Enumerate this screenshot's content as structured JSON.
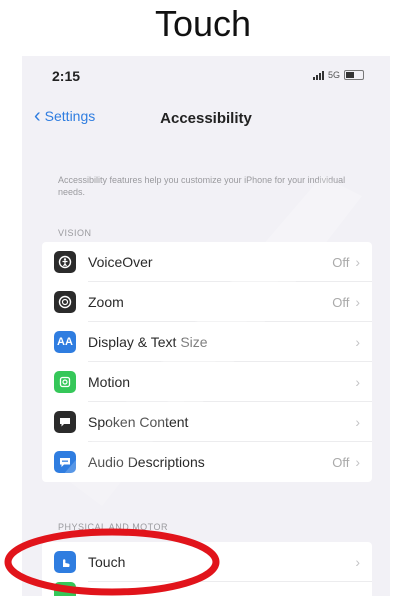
{
  "caption": "Touch",
  "status_bar": {
    "time": "2:15",
    "network": "5G"
  },
  "nav": {
    "back_label": "Settings",
    "title": "Accessibility"
  },
  "intro": "Accessibility features help you customize your iPhone for your individual needs.",
  "sections": {
    "vision_header": "VISION",
    "physical_header": "PHYSICAL AND MOTOR"
  },
  "vision_items": [
    {
      "label": "VoiceOver",
      "value": "Off",
      "icon": "voiceover-icon",
      "color": "#2b2b2b"
    },
    {
      "label": "Zoom",
      "value": "Off",
      "icon": "zoom-icon",
      "color": "#2b2b2b"
    },
    {
      "label": "Display & Text Size",
      "value": "",
      "icon": "display-text-size-icon",
      "icon_text": "AA",
      "color": "#2f7de0"
    },
    {
      "label": "Motion",
      "value": "",
      "icon": "motion-icon",
      "color": "#35c759"
    },
    {
      "label": "Spoken Content",
      "value": "",
      "icon": "spoken-content-icon",
      "color": "#2b2b2b"
    },
    {
      "label": "Audio Descriptions",
      "value": "Off",
      "icon": "audio-descriptions-icon",
      "color": "#2f7de0"
    }
  ],
  "physical_items": [
    {
      "label": "Touch",
      "icon": "touch-icon",
      "color": "#2f7de0"
    }
  ],
  "highlight_color": "#e1141b"
}
